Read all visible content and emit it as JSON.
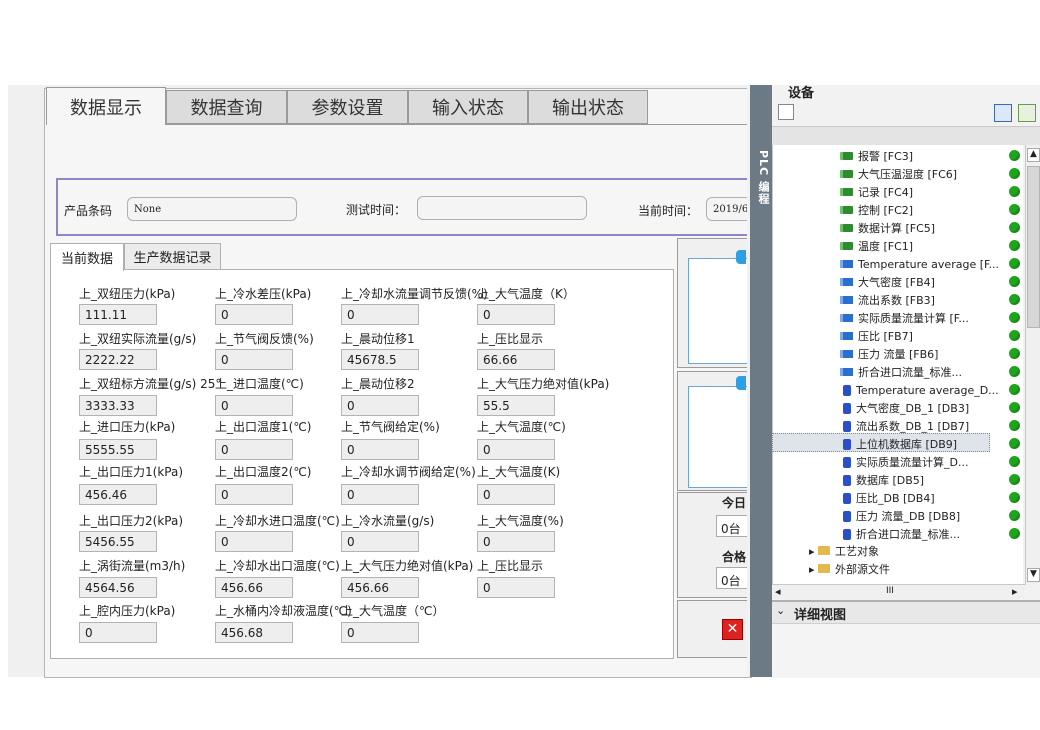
{
  "tabs": [
    "数据显示",
    "数据查询",
    "参数设置",
    "输入状态",
    "输出状态"
  ],
  "header": {
    "barcode_label": "产品条码",
    "barcode_value": "None",
    "test_time_label": "测试时间：",
    "test_time_value": "",
    "current_time_label": "当前时间：",
    "current_time_value": "2019/6"
  },
  "subtabs": [
    "当前数据",
    "生产数据记录"
  ],
  "fields": [
    {
      "label": "上_双纽压力(kPa)",
      "value": "111.11"
    },
    {
      "label": "上_冷水差压(kPa)",
      "value": "0"
    },
    {
      "label": "上_冷却水流量调节反馈(%)",
      "value": "0"
    },
    {
      "label": "上_大气温度（K）",
      "value": "0"
    },
    {
      "label": "上_双纽实际流量(g/s)",
      "value": "2222.22"
    },
    {
      "label": "上_节气阀反馈(%)",
      "value": "0"
    },
    {
      "label": "上_晨动位移1",
      "value": "45678.5"
    },
    {
      "label": "上_压比显示",
      "value": "66.66"
    },
    {
      "label": "上_双纽标方流量(g/s) 25°",
      "value": "3333.33"
    },
    {
      "label": "上_进口温度(℃)",
      "value": "0"
    },
    {
      "label": "上_晨动位移2",
      "value": "0"
    },
    {
      "label": "上_大气压力绝对值(kPa)",
      "value": "55.5"
    },
    {
      "label": "上_进口压力(kPa)",
      "value": "5555.55"
    },
    {
      "label": "上_出口温度1(℃)",
      "value": "0"
    },
    {
      "label": "上_节气阀给定(%)",
      "value": "0"
    },
    {
      "label": "上_大气温度(℃)",
      "value": "0"
    },
    {
      "label": "上_出口压力1(kPa)",
      "value": "456.46"
    },
    {
      "label": "上_出口温度2(℃)",
      "value": "0"
    },
    {
      "label": "上_冷却水调节阀给定(%)",
      "value": "0"
    },
    {
      "label": "上_大气温度(K)",
      "value": "0"
    },
    {
      "label": "上_出口压力2(kPa)",
      "value": "5456.55"
    },
    {
      "label": "上_冷却水进口温度(℃)",
      "value": "0"
    },
    {
      "label": "上_冷水流量(g/s)",
      "value": "0"
    },
    {
      "label": "上_大气温度(%)",
      "value": "0"
    },
    {
      "label": "上_涡街流量(m3/h)",
      "value": "4564.56"
    },
    {
      "label": "上_冷却水出口温度(℃)",
      "value": "456.66"
    },
    {
      "label": "上_大气压力绝对值(kPa)",
      "value": "456.66"
    },
    {
      "label": "上_压比显示",
      "value": "0"
    },
    {
      "label": "上_腔内压力(kPa)",
      "value": "0"
    },
    {
      "label": "上_水桶内冷却液温度(℃)",
      "value": "456.68"
    },
    {
      "label": "上_大气温度（℃）",
      "value": "0"
    }
  ],
  "right_panel": {
    "today_label": "今日",
    "today_value": "0台",
    "pass_label": "合格",
    "pass_value": "0台"
  },
  "tia": {
    "vertical_tab": "PLC 编程",
    "devices_title": "设备",
    "items": [
      {
        "type": "fc",
        "label": "报警 [FC3]"
      },
      {
        "type": "fc",
        "label": "大气压温湿度 [FC6]"
      },
      {
        "type": "fc",
        "label": "记录 [FC4]"
      },
      {
        "type": "fc",
        "label": "控制 [FC2]"
      },
      {
        "type": "fc",
        "label": "数据计算 [FC5]"
      },
      {
        "type": "fc",
        "label": "温度 [FC1]"
      },
      {
        "type": "fb",
        "label": "Temperature average [F..."
      },
      {
        "type": "fb",
        "label": "大气密度 [FB4]"
      },
      {
        "type": "fb",
        "label": "流出系数 [FB3]"
      },
      {
        "type": "fb",
        "label": "实际质量流量计算 [F..."
      },
      {
        "type": "fb",
        "label": "压比 [FB7]"
      },
      {
        "type": "fb",
        "label": "压力 流量 [FB6]"
      },
      {
        "type": "fb",
        "label": "折合进口流量_标准..."
      },
      {
        "type": "db",
        "label": "Temperature average_D..."
      },
      {
        "type": "db",
        "label": "大气密度_DB_1 [DB3]"
      },
      {
        "type": "db",
        "label": "流出系数_DB_1 [DB7]"
      },
      {
        "type": "db",
        "label": "上位机数据库 [DB9]"
      },
      {
        "type": "db",
        "label": "实际质量流量计算_D..."
      },
      {
        "type": "db",
        "label": "数据库 [DB5]"
      },
      {
        "type": "db",
        "label": "压比_DB [DB4]"
      },
      {
        "type": "db",
        "label": "压力 流量_DB [DB8]"
      },
      {
        "type": "db",
        "label": "折合进口流量_标准..."
      }
    ],
    "folders": [
      "工艺对象",
      "外部源文件"
    ],
    "scroll_mark": "III",
    "detail_title": "详细视图"
  }
}
